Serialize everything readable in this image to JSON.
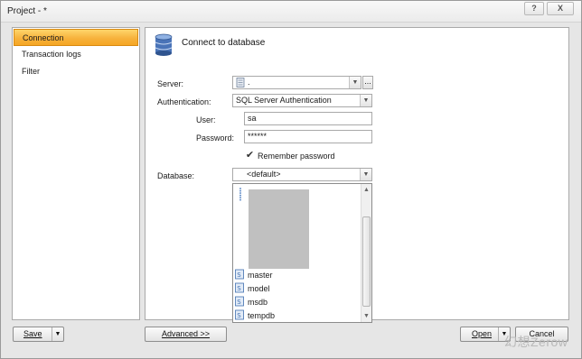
{
  "window": {
    "title": "Project - *",
    "help_label": "?",
    "close_label": "X"
  },
  "nav": {
    "items": [
      {
        "label": "Connection",
        "selected": true
      },
      {
        "label": "Transaction logs",
        "selected": false
      },
      {
        "label": "Filter",
        "selected": false
      }
    ]
  },
  "header": {
    "title": "Connect to database",
    "icon": "database-icon"
  },
  "form": {
    "server_label": "Server:",
    "server_value": ".",
    "browse_label": "...",
    "auth_label": "Authentication:",
    "auth_value": "SQL Server Authentication",
    "user_label": "User:",
    "user_value": "sa",
    "password_label": "Password:",
    "password_value": "******",
    "remember_label": "Remember password",
    "remember_checked": true,
    "database_label": "Database:",
    "database_value": "<default>"
  },
  "database_list": {
    "items": [
      {
        "label": "master"
      },
      {
        "label": "model"
      },
      {
        "label": "msdb"
      },
      {
        "label": "tempdb"
      }
    ]
  },
  "footer": {
    "save_label": "Save",
    "advanced_label": "Advanced >>",
    "open_label": "Open",
    "cancel_label": "Cancel",
    "watermark": "幻想Zerow"
  },
  "colors": {
    "selected_nav": "#f7b23d",
    "background": "#e6e6e6"
  }
}
